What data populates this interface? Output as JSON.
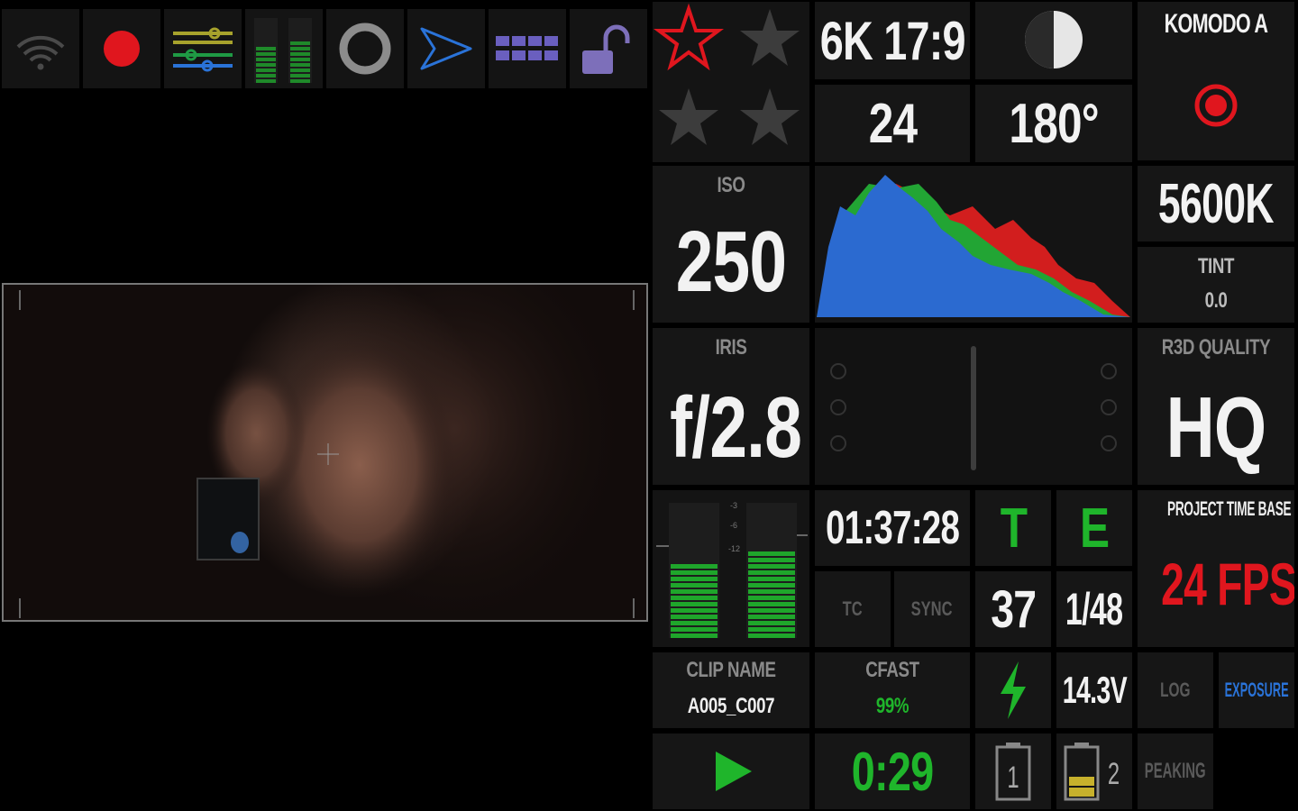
{
  "toolbar": {
    "icons": [
      "wifi-icon",
      "record-dot-icon",
      "sliders-icon",
      "audio-meter-icon",
      "ring-icon",
      "send-icon",
      "grid-icon",
      "unlock-icon"
    ]
  },
  "stars": {
    "active_color": "#e0161e",
    "inactive_color": "#3c3c3c"
  },
  "format": "6K 17:9",
  "fps": "24",
  "shutter_angle": "180°",
  "camera": {
    "name": "KOMODO A"
  },
  "iso": {
    "label": "ISO",
    "value": "250"
  },
  "white_balance": {
    "kelvin": "5600K",
    "tint_label": "TINT",
    "tint_value": "0.0"
  },
  "iris": {
    "label": "IRIS",
    "value": "f/2.8"
  },
  "r3d": {
    "label": "R3D QUALITY",
    "value": "HQ"
  },
  "timecode": {
    "value": "01:37:28",
    "tc_label": "TC",
    "sync_label": "SYNC"
  },
  "te": {
    "t_label": "T",
    "e_label": "E",
    "t_value": "37",
    "e_value": "1/48"
  },
  "project_time_base": {
    "label": "PROJECT TIME BASE",
    "value": "24 FPS"
  },
  "clip": {
    "label": "CLIP NAME",
    "value": "A005_C007"
  },
  "cfast": {
    "label": "CFAST",
    "value": "99%"
  },
  "power": {
    "voltage": "14.3V"
  },
  "buttons": {
    "log": "LOG",
    "exposure": "EXPOSURE",
    "peaking": "PEAKING"
  },
  "record_time": "0:29",
  "batteries": {
    "slot1": "1",
    "slot2": "2"
  },
  "audio_meter": {
    "ticks": [
      "-3",
      "-6",
      "-12"
    ],
    "left_level": 0.55,
    "right_level": 0.67
  },
  "colors": {
    "green": "#1fb52b",
    "red": "#e0161e",
    "blue": "#2a73d8",
    "purple": "#6a5fbf"
  }
}
